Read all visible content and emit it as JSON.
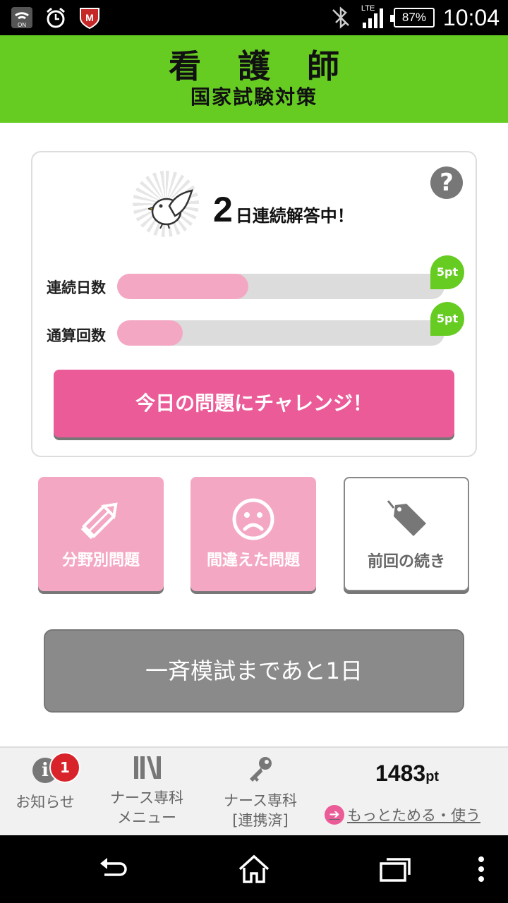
{
  "status_bar": {
    "battery": "87%",
    "network": "LTE",
    "time": "10:04",
    "icons": [
      "wifi-on-icon",
      "alarm-icon",
      "mcafee-icon",
      "bluetooth-off-icon",
      "signal-icon",
      "battery-icon"
    ]
  },
  "header": {
    "title": "看 護 師",
    "subtitle": "国家試験対策"
  },
  "streak_card": {
    "days": "2",
    "text": "日連続解答中！",
    "help_icon": "?",
    "rows": [
      {
        "label": "連続日数",
        "progress": 0.4,
        "badge": "5pt"
      },
      {
        "label": "通算回数",
        "progress": 0.2,
        "badge": "5pt"
      }
    ],
    "challenge_label": "今日の問題にチャレンジ！"
  },
  "tiles": [
    {
      "label": "分野別問題",
      "icon": "pencil-icon"
    },
    {
      "label": "間違えた問題",
      "icon": "sad-face-icon"
    },
    {
      "label": "前回の続き",
      "icon": "tag-icon"
    }
  ],
  "mock_exam": {
    "label": "一斉模試まであと1日"
  },
  "footer": {
    "notice_label": "お知らせ",
    "notice_count": "1",
    "menu_label_1": "ナース専科",
    "menu_label_2": "メニュー",
    "partner_label_1": "ナース専科",
    "partner_label_2": "[連携済]",
    "points": "1483",
    "points_unit": "pt",
    "more_label": "もっとためる・使う",
    "more_arrow": "➔"
  },
  "colors": {
    "header_green": "#66cc22",
    "accent_pink": "#eb5b98",
    "light_pink": "#f4a7c3",
    "mock_gray": "#8a8a8a"
  }
}
